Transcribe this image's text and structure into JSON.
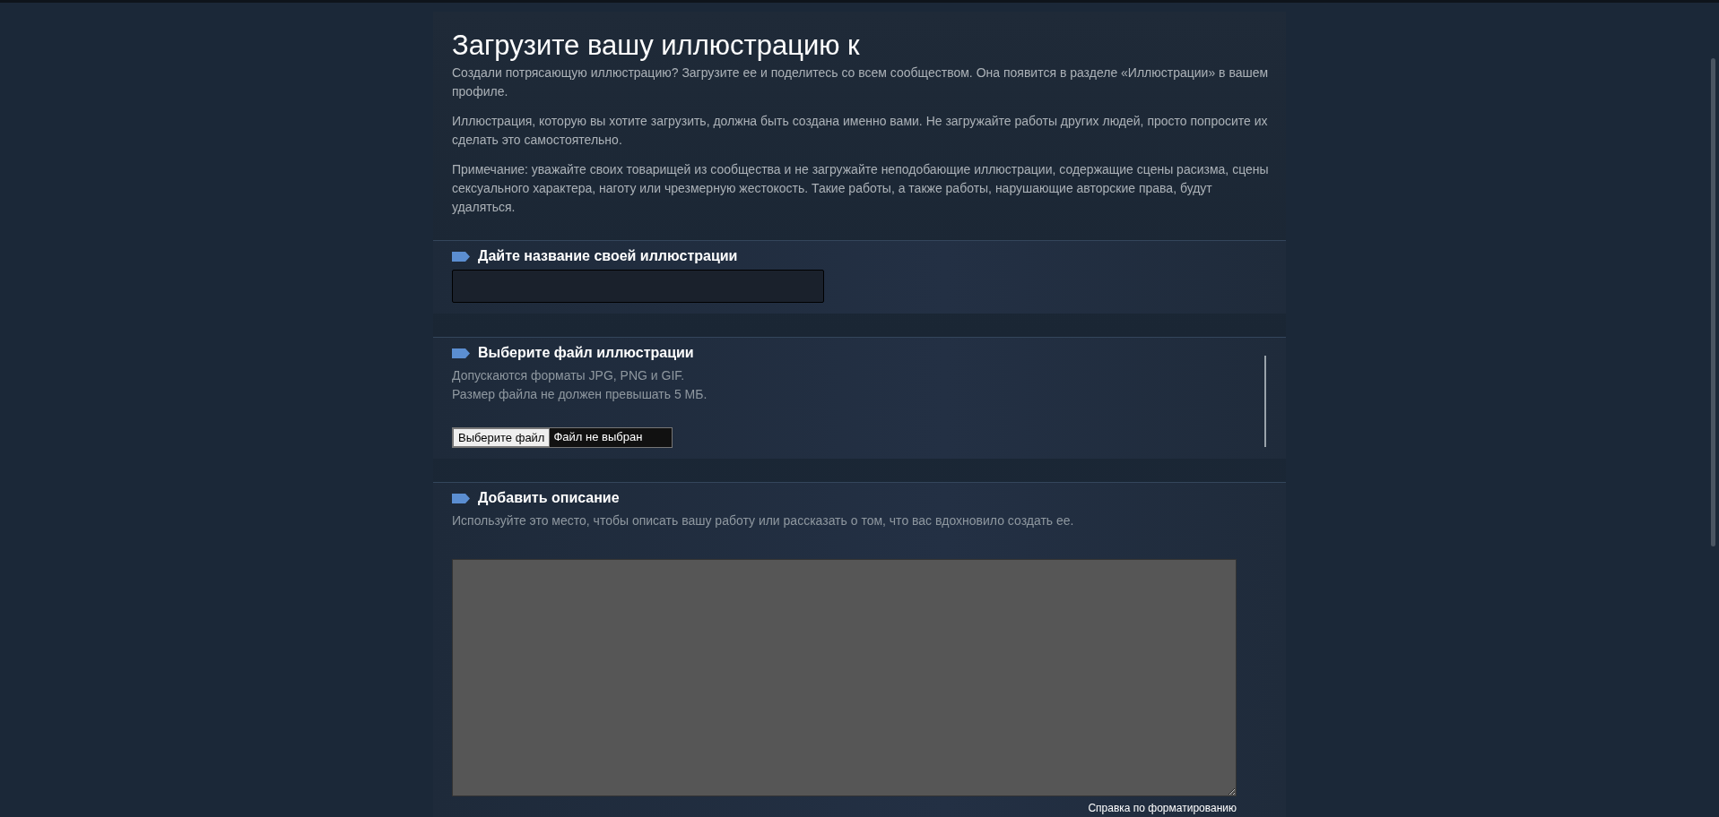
{
  "page": {
    "title": "Загрузите вашу иллюстрацию к",
    "paragraphs": [
      "Создали потрясающую иллюстрацию? Загрузите ее и поделитесь со всем сообществом. Она появится в разделе «Иллюстрации» в вашем профиле.",
      "Иллюстрация, которую вы хотите загрузить, должна быть создана именно вами. Не загружайте работы других людей, просто попросите их сделать это самостоятельно.",
      "Примечание: уважайте своих товарищей из сообщества и не загружайте неподобающие иллюстрации, содержащие сцены расизма, сцены сексуального характера, наготу или чрезмерную жестокость. Такие работы, а также работы, нарушающие авторские права, будут удаляться."
    ]
  },
  "sections": [
    {
      "kind": "text-input",
      "heading": "Дайте название своей иллюстрации"
    },
    {
      "kind": "file",
      "heading": "Выберите файл иллюстрации",
      "notes": [
        "Допускаются форматы JPG, PNG и GIF.",
        "Размер файла не должен превышать 5 МБ."
      ],
      "file_button": "Выберите файл",
      "file_status": "Файл не выбран"
    },
    {
      "kind": "textarea",
      "heading": "Добавить описание",
      "notes": [
        "Используйте это место, чтобы описать вашу работу или рассказать о том, что вас вдохновило создать ее."
      ],
      "help_link": "Справка по форматированию"
    }
  ]
}
